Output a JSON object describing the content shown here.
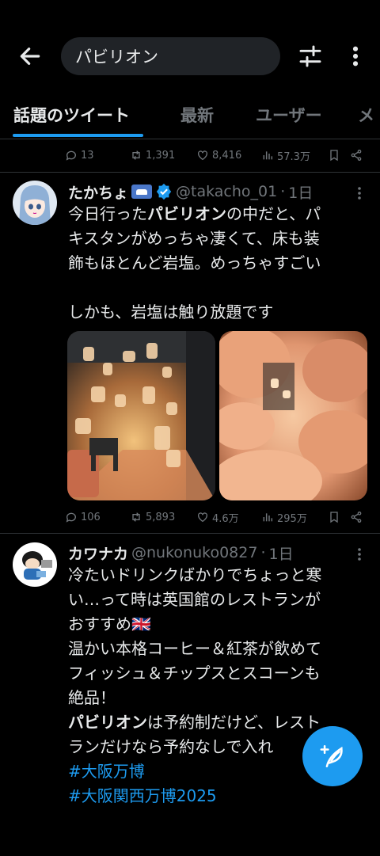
{
  "header": {
    "search_value": "パビリオン",
    "tabs": [
      {
        "label": "話題のツイート",
        "active": true
      },
      {
        "label": "最新",
        "active": false
      },
      {
        "label": "ユーザー",
        "active": false
      },
      {
        "label": "メ",
        "active": false
      }
    ]
  },
  "prev_tweet_actions": {
    "replies": "13",
    "retweets": "1,391",
    "likes": "8,416",
    "views": "57.3万"
  },
  "tweets": [
    {
      "name": "たかちょ",
      "verified": true,
      "handle": "@takacho_01",
      "time": "1日",
      "text_lines": [
        {
          "pre": "今日行った",
          "hl": "パビリオン",
          "post": "の中だと、パ"
        },
        {
          "pre": "キスタンがめっちゃ凄くて、床も装",
          "hl": "",
          "post": ""
        },
        {
          "pre": "飾もほとんど岩塩。めっちゃすごい",
          "hl": "",
          "post": ""
        },
        {
          "pre": "",
          "hl": "",
          "post": ""
        },
        {
          "pre": "しかも、岩塩は触り放題です",
          "hl": "",
          "post": ""
        }
      ],
      "actions": {
        "replies": "106",
        "retweets": "5,893",
        "likes": "4.6万",
        "views": "295万"
      }
    },
    {
      "name": "カワナカ",
      "verified": false,
      "handle": "@nukonuko0827",
      "time": "1日",
      "lines": [
        "冷たいドリンクばかりでちょっと寒",
        "い…って時は英国館のレストランが",
        "おすすめ🇬🇧",
        "温かい本格コーヒー＆紅茶が飲めて",
        "フィッシュ＆チップスとスコーンも",
        "絶品！"
      ],
      "line7_hl": "パビリオン",
      "line7_post": "は予約制だけど、レスト",
      "line8": "ランだけなら予約なしで入れ",
      "hashtags": [
        "#大阪万博",
        "#大阪関西万博2025"
      ]
    }
  ],
  "separator": "·",
  "colors": {
    "accent": "#1d9bf0",
    "background": "#000000",
    "muted": "#71767b",
    "text": "#e7e9ea",
    "divider": "#2f3336"
  },
  "icons": [
    "back-arrow-icon",
    "filter-icon",
    "more-vertical-icon",
    "reply-icon",
    "retweet-icon",
    "like-icon",
    "views-icon",
    "bookmark-icon",
    "share-icon",
    "verified-icon",
    "compose-icon"
  ]
}
